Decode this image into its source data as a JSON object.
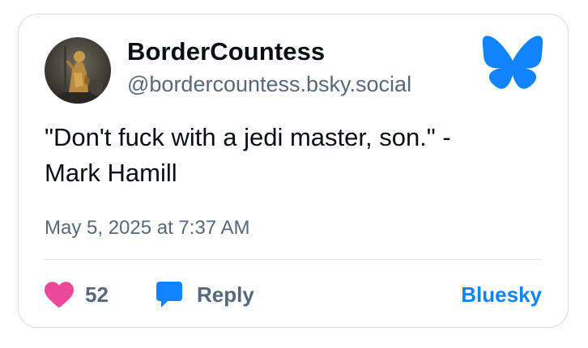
{
  "post": {
    "author_name": "BorderCountess",
    "author_handle": "@bordercountess.bsky.social",
    "text": "\"Don't fuck with a jedi master, son.\" -\nMark Hamill",
    "timestamp": "May 5, 2025 at 7:37 AM"
  },
  "footer": {
    "like_count": "52",
    "reply_label": "Reply",
    "link_label": "Bluesky"
  },
  "colors": {
    "brand_blue": "#1083fe",
    "heart_pink": "#ec4899",
    "reply_blue": "#1083fe",
    "muted_text": "#56687a"
  },
  "icons": {
    "logo": "bluesky-butterfly-icon",
    "like": "heart-icon",
    "reply": "speech-bubble-icon"
  }
}
